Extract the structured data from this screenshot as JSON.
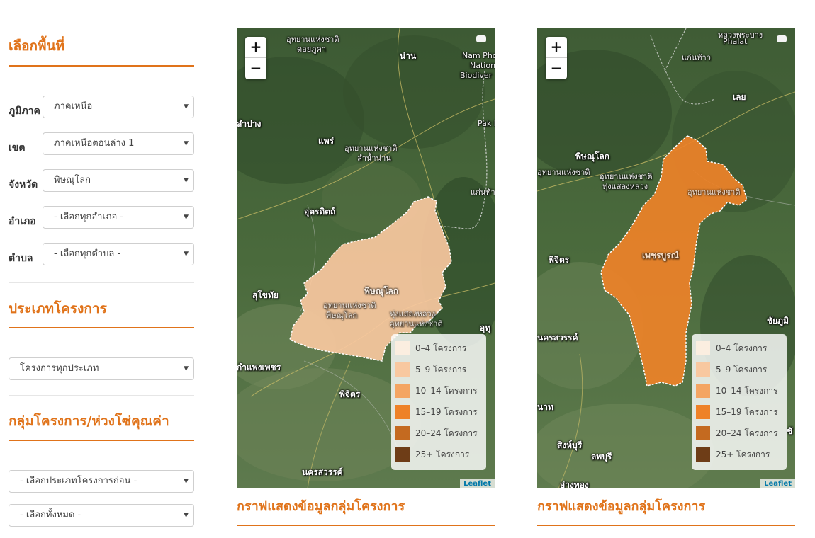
{
  "sidebar": {
    "area_title": "เลือกพื้นที่",
    "fields": [
      {
        "label": "ภูมิภาค",
        "value": "ภาคเหนือ"
      },
      {
        "label": "เขต",
        "value": "ภาคเหนือตอนล่าง 1"
      },
      {
        "label": "จังหวัด",
        "value": "พิษณุโลก"
      },
      {
        "label": "อำเภอ",
        "value": "- เลือกทุกอำเภอ -"
      },
      {
        "label": "ตำบล",
        "value": "- เลือกทุกตำบล -"
      }
    ],
    "project_type_title": "ประเภทโครงการ",
    "project_type_value": "โครงการทุกประเภท",
    "group_title": "กลุ่มโครงการ/ห่วงโซ่คุณค่า",
    "group_select_1": "- เลือกประเภทโครงการก่อน -",
    "group_select_2": "- เลือกทั้งหมด -"
  },
  "map_controls": {
    "zoom_in": "+",
    "zoom_out": "−",
    "attribution": "Leaflet"
  },
  "legend": [
    {
      "label": "0–4 โครงการ",
      "color": "#fbeee0"
    },
    {
      "label": "5–9 โครงการ",
      "color": "#f8c8a0"
    },
    {
      "label": "10–14 โครงการ",
      "color": "#f4a562"
    },
    {
      "label": "15–19 โครงการ",
      "color": "#ee8228"
    },
    {
      "label": "20–24 โครงการ",
      "color": "#c46a20"
    },
    {
      "label": "25+ โครงการ",
      "color": "#6e3d17"
    }
  ],
  "maps": [
    {
      "caption": "กราฟแสดงข้อมูลกลุ่มโครงการ",
      "region": "พิษณุโลก",
      "fill": "#f8c8a0",
      "places": [
        "อุทยานแห่งชาติ",
        "ดอยภูคา",
        "น่าน",
        "Nam Phong",
        "Nation",
        "Biodiver",
        "Pak L",
        "ลำปาง",
        "แพร่",
        "อุทยานแห่งชาติ",
        "ลำน้ำน่าน",
        "แก่นท้า",
        "อุตรดิตถ์",
        "สุโขทัย",
        "พิษณุโลก",
        "อุทยานแห่งชาติ",
        "ทุ่งแสลงหลวง",
        "อุทยานแห่งชาติ",
        "พิษณุโลก",
        "อุทุ",
        "กำแพงเพชร",
        "พิจิตร",
        "นครสวรรค์"
      ]
    },
    {
      "caption": "กราฟแสดงข้อมูลกลุ่มโครงการ",
      "region": "เพชรบูรณ์",
      "fill": "#ee8228",
      "places": [
        "หลวงพระบาง",
        "Phalat",
        "แก่นท้าว",
        "เลย",
        "พิษณุโลก",
        "อุทยานแห่งชาติ",
        "อุทยานแห่งชาติ",
        "ทุ่งแสลงหลวง",
        "อุทยานแห่งชาติ",
        "พิจิตร",
        "เพชรบูรณ์",
        "ชัยภูมิ",
        "นครสวรรค์",
        "สิงห์บุรี",
        "ลพบุรี",
        "อ่างทอง",
        "นาท",
        "ชั"
      ]
    }
  ]
}
